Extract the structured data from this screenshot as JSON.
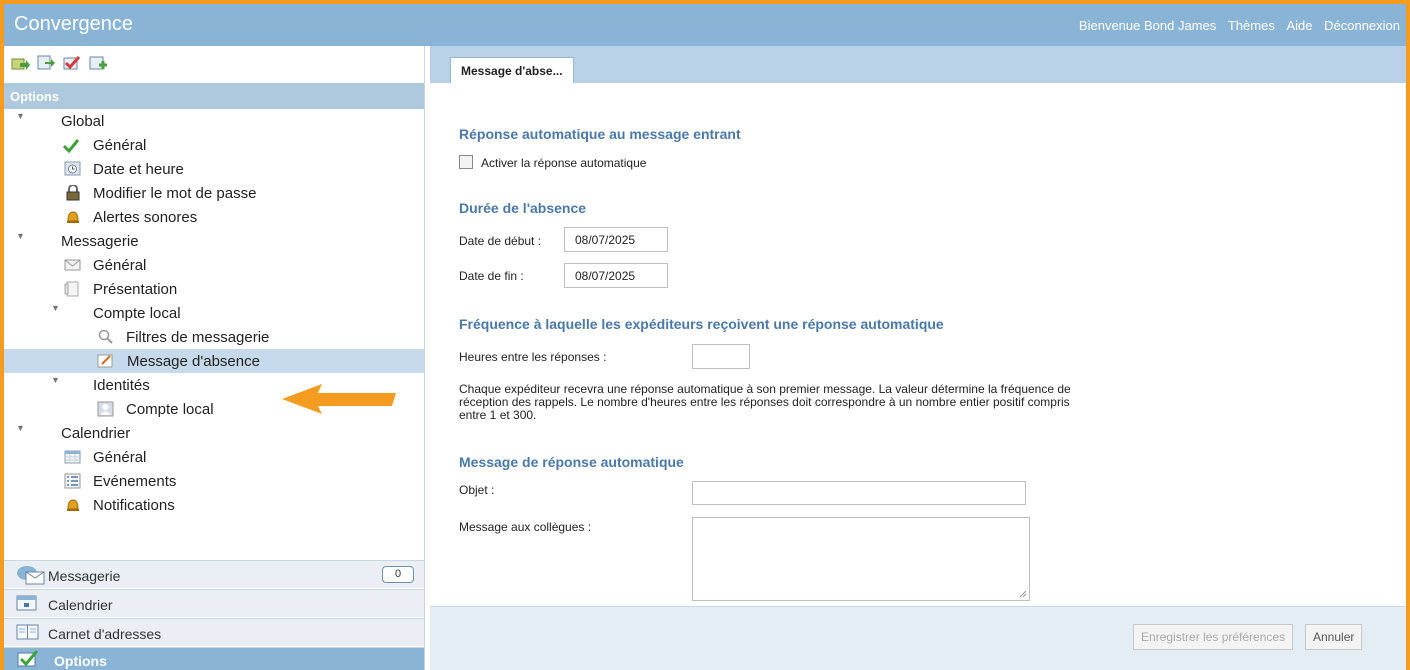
{
  "app": {
    "title": "Convergence",
    "welcome": "Bienvenue Bond James",
    "links": [
      "Thèmes",
      "Aide",
      "Déconnexion"
    ]
  },
  "left": {
    "options_header": "Options",
    "tree": {
      "global": "Global",
      "global_general": "Général",
      "date_heure": "Date et heure",
      "mot_de_passe": "Modifier le mot de passe",
      "alertes": "Alertes sonores",
      "messagerie": "Messagerie",
      "msg_general": "Général",
      "presentation": "Présentation",
      "compte_local": "Compte local",
      "filtres": "Filtres de messagerie",
      "absence": "Message d'absence",
      "identites": "Identités",
      "identite_compte": "Compte local",
      "calendrier": "Calendrier",
      "cal_general": "Général",
      "evenements": "Evénements",
      "notifications": "Notifications"
    },
    "nav": {
      "messagerie": "Messagerie",
      "messagerie_count": "0",
      "calendrier": "Calendrier",
      "carnet": "Carnet d'adresses",
      "options": "Options"
    }
  },
  "right": {
    "tab_label": "Message d'abse...",
    "sec_auto": "Réponse automatique au message entrant",
    "enable_label": "Activer la réponse automatique",
    "sec_duree": "Durée de l'absence",
    "date_debut_label": "Date de début :",
    "date_debut_value": "08/07/2025",
    "date_fin_label": "Date de fin :",
    "date_fin_value": "08/07/2025",
    "sec_freq": "Fréquence à laquelle les expéditeurs reçoivent une réponse automatique",
    "heures_label": "Heures entre les réponses :",
    "heures_value": "",
    "help": "Chaque expéditeur recevra une réponse automatique à son premier message. La valeur détermine la fréquence de réception des rappels. Le nombre d'heures entre les réponses doit correspondre à un nombre entier positif compris entre 1 et 300.",
    "sec_msg": "Message de réponse automatique",
    "objet_label": "Objet :",
    "objet_value": "",
    "message_label": "Message aux collègues :",
    "save_label": "Enregistrer les préférences",
    "cancel_label": "Annuler"
  },
  "colors": {
    "header": "#8ab4d6",
    "section_title": "#4a79a8",
    "selection": "#c6daeb",
    "annotation_arrow": "#f39c1f"
  }
}
